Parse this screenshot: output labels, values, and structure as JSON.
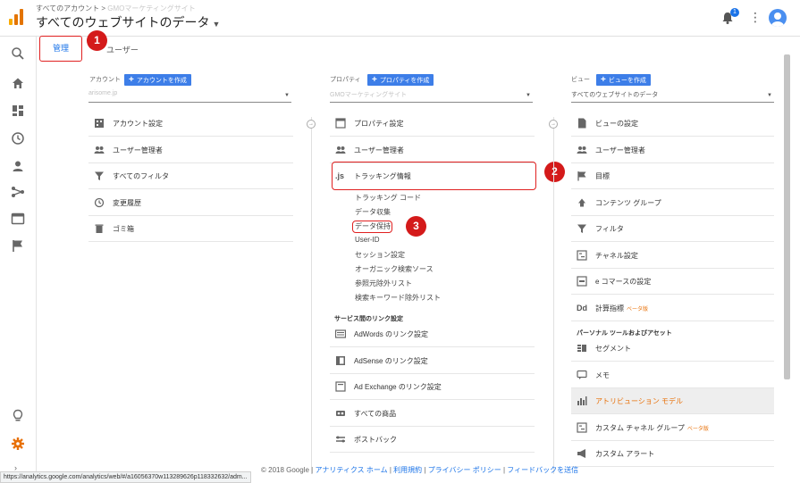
{
  "header": {
    "breadcrumb_prefix": "すべてのアカウント",
    "breadcrumb_sep": ">",
    "breadcrumb_account": "GMOマーケティングサイト",
    "title": "すべてのウェブサイトのデータ",
    "notification_count": "1",
    "logo_colors": [
      "#f9ab00",
      "#e37400",
      "#e37400"
    ]
  },
  "tabs": {
    "admin": "管理",
    "user": "ユーザー"
  },
  "account": {
    "header": "アカウント",
    "create_label": "アカウントを作成",
    "selected": "arisome.jp",
    "items": [
      {
        "label": "アカウント設定",
        "icon": "building-icon"
      },
      {
        "label": "ユーザー管理者",
        "icon": "people-icon"
      },
      {
        "label": "すべてのフィルタ",
        "icon": "filter-icon"
      },
      {
        "label": "変更履歴",
        "icon": "history-icon"
      },
      {
        "label": "ゴミ箱",
        "icon": "trash-icon"
      }
    ]
  },
  "property": {
    "header": "プロパティ",
    "create_label": "プロパティを作成",
    "selected": "GMOマーケティングサイト",
    "items": [
      {
        "label": "プロパティ設定",
        "icon": "window-icon"
      },
      {
        "label": "ユーザー管理者",
        "icon": "people-icon"
      },
      {
        "label": "トラッキング情報",
        "icon": "js-icon",
        "icon_text": ".js"
      }
    ],
    "tracking_sub": [
      "トラッキング コード",
      "データ収集",
      "データ保持",
      "User-ID",
      "セッション設定",
      "オーガニック検索ソース",
      "参照元除外リスト",
      "検索キーワード除外リスト"
    ],
    "links_section": "サービス間のリンク設定",
    "links": [
      {
        "label": "AdWords のリンク設定",
        "icon": "adwords-icon"
      },
      {
        "label": "AdSense のリンク設定",
        "icon": "adsense-icon"
      },
      {
        "label": "Ad Exchange のリンク設定",
        "icon": "adexchange-icon"
      },
      {
        "label": "すべての商品",
        "icon": "products-icon"
      },
      {
        "label": "ポストバック",
        "icon": "postback-icon"
      }
    ]
  },
  "view": {
    "header": "ビュー",
    "create_label": "ビューを作成",
    "selected": "すべてのウェブサイトのデータ",
    "items": [
      {
        "label": "ビューの設定",
        "icon": "doc-icon"
      },
      {
        "label": "ユーザー管理者",
        "icon": "people-icon"
      },
      {
        "label": "目標",
        "icon": "flag-icon"
      },
      {
        "label": "コンテンツ グループ",
        "icon": "content-group-icon"
      },
      {
        "label": "フィルタ",
        "icon": "filter-icon"
      },
      {
        "label": "チャネル設定",
        "icon": "channel-icon"
      },
      {
        "label": "e コマースの設定",
        "icon": "cart-icon"
      },
      {
        "label": "計算指標",
        "icon": "dd-icon",
        "icon_text": "Dd",
        "beta": "ベータ版"
      }
    ],
    "personal_section": "パーソナル ツールおよびアセット",
    "personal": [
      {
        "label": "セグメント",
        "icon": "segment-icon"
      },
      {
        "label": "メモ",
        "icon": "memo-icon"
      },
      {
        "label": "アトリビューション モデル",
        "icon": "bar-chart-icon",
        "highlight": true
      },
      {
        "label": "カスタム チャネル グループ",
        "icon": "channel-icon",
        "beta": "ベータ版"
      },
      {
        "label": "カスタム アラート",
        "icon": "megaphone-icon"
      }
    ]
  },
  "callouts": [
    "1",
    "2",
    "3"
  ],
  "footer": {
    "copyright": "© 2018 Google",
    "links": [
      "アナリティクス ホーム",
      "利用規約",
      "プライバシー ポリシー",
      "フィードバックを送信"
    ],
    "sep": "|"
  },
  "statusbar": "https://analytics.google.com/analytics/web/#/a16056370w113289626p118332632/adm..."
}
